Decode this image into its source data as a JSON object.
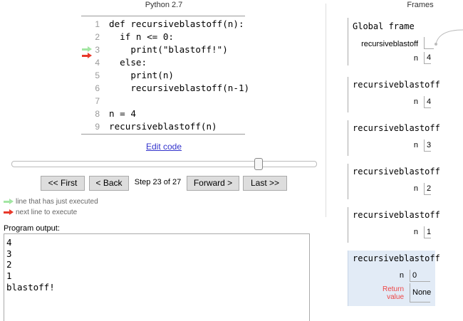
{
  "code_panel": {
    "language": "Python 2.7",
    "lines": [
      {
        "num": "1",
        "text": "def recursiveblastoff(n):"
      },
      {
        "num": "2",
        "text": "  if n <= 0:"
      },
      {
        "num": "3",
        "text": "    print(\"blastoff!\")"
      },
      {
        "num": "4",
        "text": "  else:"
      },
      {
        "num": "5",
        "text": "    print(n)"
      },
      {
        "num": "6",
        "text": "    recursiveblastoff(n-1)"
      },
      {
        "num": "7",
        "text": ""
      },
      {
        "num": "8",
        "text": "n = 4"
      },
      {
        "num": "9",
        "text": "recursiveblastoff(n)"
      }
    ],
    "just_executed_line": "3",
    "next_line": "4",
    "edit_link": "Edit code"
  },
  "navigation": {
    "slider_progress": 0.8519,
    "first": "<< First",
    "back": "< Back",
    "step_text": "Step 23 of 27",
    "forward": "Forward >",
    "last": "Last >>"
  },
  "legend": {
    "just_executed": "line that has just executed",
    "next_line": "next line to execute"
  },
  "output": {
    "label": "Program output:",
    "text": "4\n3\n2\n1\nblastoff!"
  },
  "frames": {
    "title": "Frames",
    "global": {
      "name": "Global frame",
      "vars": [
        {
          "name": "recursiveblastoff",
          "value": ""
        },
        {
          "name": "n",
          "value": "4"
        }
      ]
    },
    "stack": [
      {
        "name": "recursiveblastoff",
        "var": "n",
        "value": "4"
      },
      {
        "name": "recursiveblastoff",
        "var": "n",
        "value": "3"
      },
      {
        "name": "recursiveblastoff",
        "var": "n",
        "value": "2"
      },
      {
        "name": "recursiveblastoff",
        "var": "n",
        "value": "1"
      },
      {
        "name": "recursiveblastoff",
        "var": "n",
        "value": "0",
        "return_label": "Return value",
        "return_value": "None"
      }
    ]
  },
  "colors": {
    "just_executed_arrow": "#a3e6a3",
    "next_line_arrow": "#e8392b",
    "active_frame_bg": "#e2ebf6",
    "return_label": "#ee4444",
    "link": "#3333cc"
  }
}
